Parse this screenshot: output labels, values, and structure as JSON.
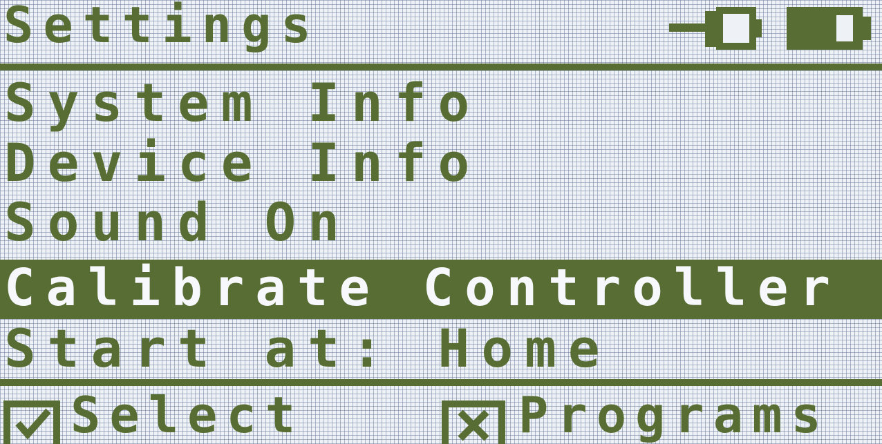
{
  "header": {
    "title": "Settings",
    "connection_icon": "plug-connector-icon",
    "battery_icon": "battery-icon",
    "battery_level": 0.6
  },
  "menu": {
    "items": [
      {
        "label": "System Info",
        "selected": false
      },
      {
        "label": "Device Info",
        "selected": false
      },
      {
        "label": "Sound On",
        "selected": false
      },
      {
        "label": "Calibrate Controller",
        "selected": true
      },
      {
        "label": "Start at: Home",
        "selected": false
      }
    ]
  },
  "footer": {
    "select": {
      "icon": "checkmark-icon",
      "label": "Select"
    },
    "programs": {
      "icon": "x-icon",
      "label": "Programs"
    }
  },
  "colors": {
    "ink": "#586d34",
    "background": "#eef1f6",
    "grid": "#6e809e"
  }
}
